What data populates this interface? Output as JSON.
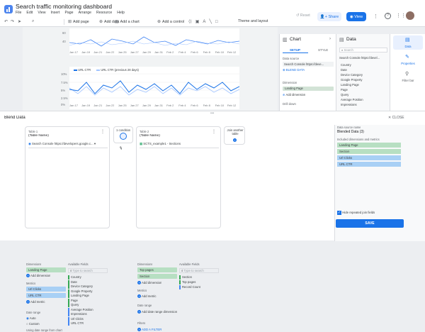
{
  "title": "Search traffic monitoring dashboard",
  "menu": [
    "File",
    "Edit",
    "View",
    "Insert",
    "Page",
    "Arrange",
    "Resource",
    "Help"
  ],
  "toolbar": {
    "add_page": "Add page",
    "add_data": "Add data",
    "add_chart": "Add a chart",
    "add_control": "Add a control",
    "theme": "Theme and layout"
  },
  "header": {
    "reset": "Reset",
    "share": "Share",
    "view": "View"
  },
  "chart_top": {
    "y_labels": [
      "60",
      "40"
    ],
    "x_labels": [
      "Jan 17",
      "Jan 19",
      "Jan 21",
      "Jan 23",
      "Jan 25",
      "Jan 27",
      "Jan 29",
      "Jan 31",
      "Feb 2",
      "Feb 4",
      "Feb 6",
      "Feb 8",
      "Feb 10",
      "Feb 12"
    ]
  },
  "chart_bottom": {
    "legend": [
      "URL CTR",
      "URL CTR (previous 28 days)"
    ],
    "y_labels": [
      "10%",
      "7.5%",
      "5%",
      "2.5%",
      "0%"
    ],
    "x_labels": [
      "Jan 17",
      "Jan 19",
      "Jan 21",
      "Jan 23",
      "Jan 25",
      "Jan 27",
      "Jan 29",
      "Jan 31",
      "Feb 2",
      "Feb 4",
      "Feb 6",
      "Feb 8",
      "Feb 10",
      "Feb 12"
    ]
  },
  "chart_panel": {
    "title": "Chart",
    "tabs": [
      "SETUP",
      "STYLE"
    ],
    "data_source_label": "Data source",
    "data_source": "Search Console https://deve...",
    "blend_data": "BLEND DATA",
    "dimension_label": "Dimension",
    "dimension": "Landing Page",
    "add_dimension": "Add dimension",
    "drill_down": "Drill down"
  },
  "data_panel": {
    "title": "Data",
    "search_placeholder": "Search",
    "source": "Search Console https://devel...",
    "fields": [
      "Country",
      "Date",
      "Device Category",
      "Google Property",
      "Landing Page",
      "Page",
      "Query",
      "Average Position",
      "Impressions"
    ]
  },
  "side_rail": [
    "Data",
    "Properties",
    "Filter bar"
  ],
  "blend": {
    "title": "Blend Data",
    "close": "CLOSE",
    "table1": {
      "title": "Table 1",
      "name": "(Table Name)",
      "source": "Search Console https://developers.google.c...",
      "dimensions_label": "Dimensions",
      "dimension": "Landing Page",
      "add_dimension": "Add dimension",
      "metrics_label": "Metrics",
      "metrics": [
        "Url Clicks",
        "URL CTR"
      ],
      "add_metric": "Add metric",
      "date_range_label": "Date range",
      "date_options": [
        "Auto",
        "Custom"
      ],
      "date_note": "Using date range from chart",
      "available_label": "Available Fields",
      "search": "Type to search",
      "available": [
        "Country",
        "Date",
        "Device Category",
        "Google Property",
        "Landing Page",
        "Page",
        "Query",
        "Average Position",
        "Impressions",
        "Url Clicks",
        "URL CTR"
      ]
    },
    "join": {
      "label": "1 condition"
    },
    "table2": {
      "title": "Table 2",
      "name": "(Table Name)",
      "source": "SCTS_example1 - Sections",
      "dimensions_label": "Dimensions",
      "dimensions": [
        "Top pages",
        "Section"
      ],
      "add_dimension": "Add dimension",
      "metrics_label": "Metrics",
      "add_metric": "Add metric",
      "date_range_label": "Date range",
      "add_date": "Add date range dimension",
      "filters_label": "Filters",
      "add_filter": "ADD A FILTER",
      "available_label": "Available Fields",
      "search": "Type to search",
      "available": [
        "Section",
        "Top pages",
        "Record Count"
      ]
    },
    "join_another": "Join another table",
    "right": {
      "source_name_label": "Data source name",
      "source_name": "Blended Data (3)",
      "included_label": "Included dimensions and metrics",
      "included": [
        "Landing Page",
        "Section",
        "Url Clicks",
        "URL CTR"
      ],
      "hide_label": "Hide repeated join fields",
      "save": "SAVE"
    }
  },
  "colors": {
    "accent": "#1a73e8",
    "green_chip": "#b7dfc2",
    "blue_chip": "#a8d0f5"
  }
}
